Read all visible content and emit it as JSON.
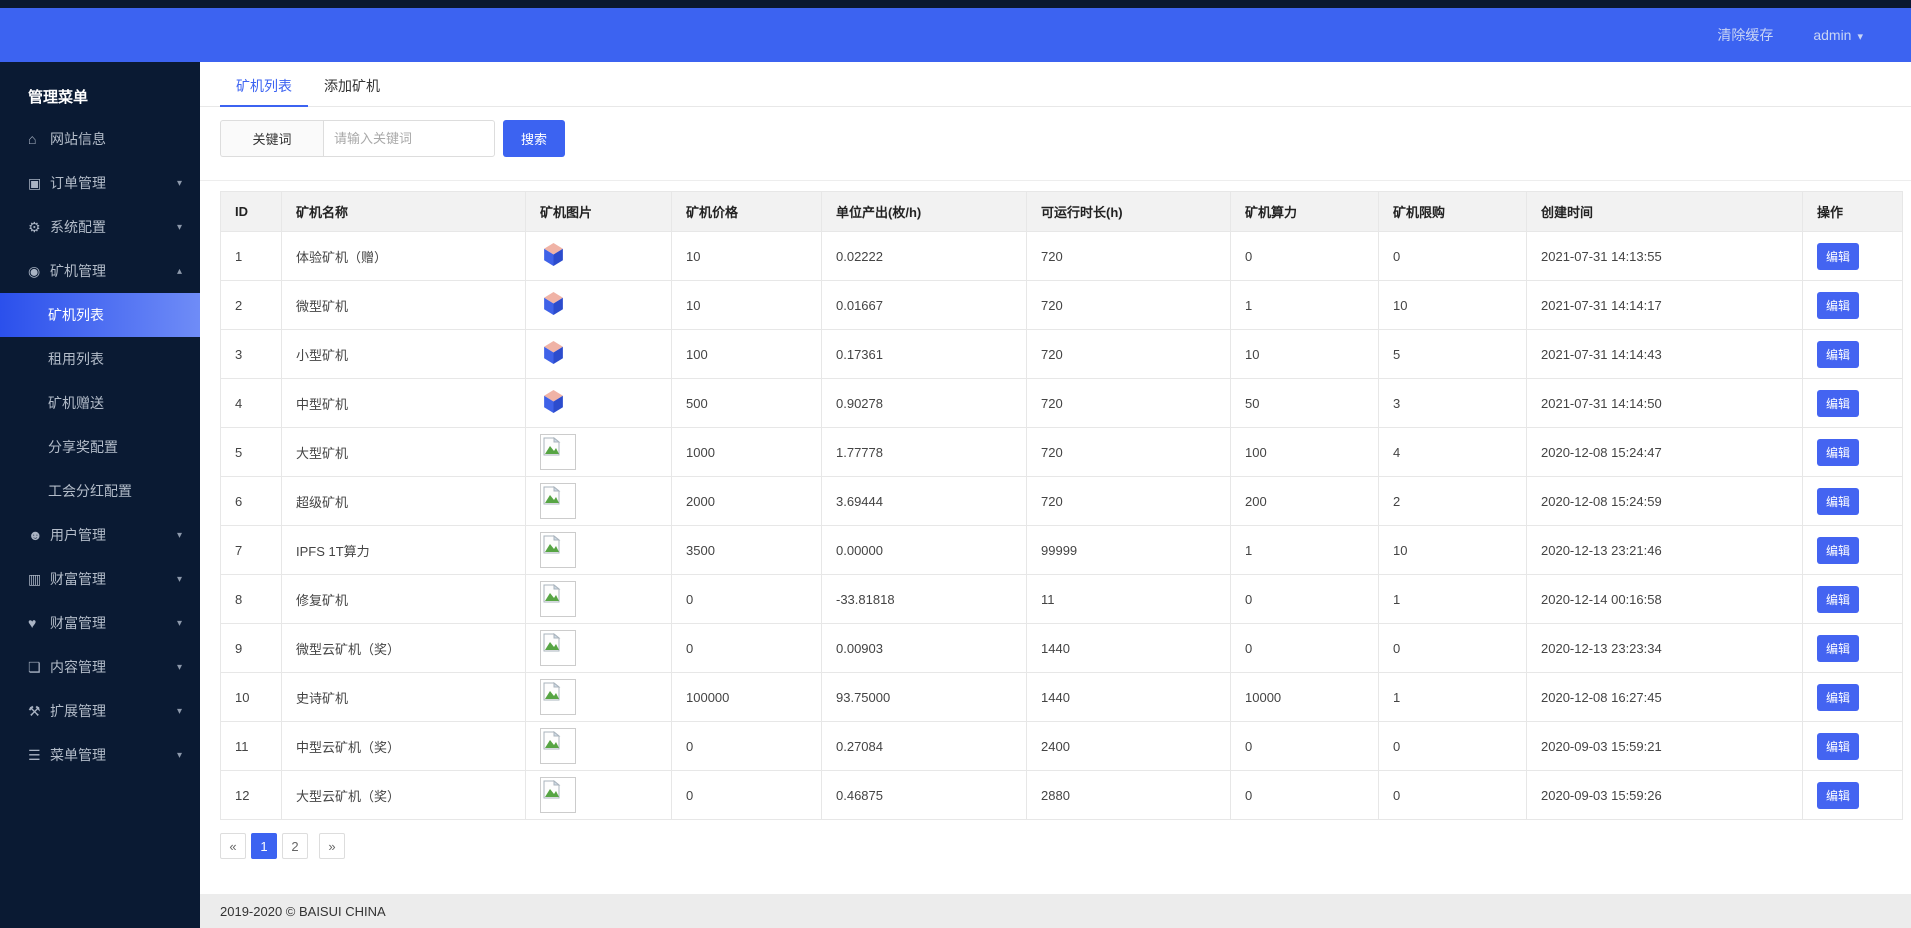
{
  "header": {
    "clear_cache": "清除缓存",
    "user": "admin"
  },
  "icons": {
    "caret_down": "▾",
    "caret_up": "▴"
  },
  "colors": {
    "accent": "#3c63f1",
    "header_bg": "#3c63f1",
    "sidebar_bg": "#0a1a33",
    "active_item_gradient": [
      "#2b50ec",
      "#6f8cf7"
    ],
    "footer_bg": "#ececec"
  },
  "sidebar": {
    "title": "管理菜单",
    "items": [
      {
        "label": "网站信息",
        "icon": "home-icon",
        "glyph": "⌂",
        "expandable": false
      },
      {
        "label": "订单管理",
        "icon": "orders-icon",
        "glyph": "▣",
        "expandable": true
      },
      {
        "label": "系统配置",
        "icon": "gears-icon",
        "glyph": "⚙",
        "expandable": true
      },
      {
        "label": "矿机管理",
        "icon": "miner-icon",
        "glyph": "◉",
        "expandable": true,
        "expanded": true,
        "children": [
          {
            "label": "矿机列表",
            "active": true
          },
          {
            "label": "租用列表"
          },
          {
            "label": "矿机赠送"
          },
          {
            "label": "分享奖配置"
          },
          {
            "label": "工会分红配置"
          }
        ]
      },
      {
        "label": "用户管理",
        "icon": "users-icon",
        "glyph": "☻",
        "expandable": true
      },
      {
        "label": "财富管理",
        "icon": "money-bill-icon",
        "glyph": "▥",
        "expandable": true
      },
      {
        "label": "财富管理",
        "icon": "heart-icon",
        "glyph": "♥",
        "expandable": true
      },
      {
        "label": "内容管理",
        "icon": "document-icon",
        "glyph": "❏",
        "expandable": true
      },
      {
        "label": "扩展管理",
        "icon": "wrench-icon",
        "glyph": "⚒",
        "expandable": true
      },
      {
        "label": "菜单管理",
        "icon": "bars-icon",
        "glyph": "☰",
        "expandable": true
      }
    ]
  },
  "tabs": [
    {
      "label": "矿机列表",
      "active": true
    },
    {
      "label": "添加矿机",
      "active": false
    }
  ],
  "search": {
    "label": "关键词",
    "placeholder": "请输入关键词",
    "button": "搜索"
  },
  "table": {
    "columns": [
      "ID",
      "矿机名称",
      "矿机图片",
      "矿机价格",
      "单位产出(枚/h)",
      "可运行时长(h)",
      "矿机算力",
      "矿机限购",
      "创建时间",
      "操作"
    ],
    "edit_label": "编辑",
    "rows": [
      {
        "id": "1",
        "name": "体验矿机（赠）",
        "image": "miner",
        "price": "10",
        "output": "0.02222",
        "hours": "720",
        "power": "0",
        "limit": "0",
        "created": "2021-07-31 14:13:55"
      },
      {
        "id": "2",
        "name": "微型矿机",
        "image": "miner",
        "price": "10",
        "output": "0.01667",
        "hours": "720",
        "power": "1",
        "limit": "10",
        "created": "2021-07-31 14:14:17"
      },
      {
        "id": "3",
        "name": "小型矿机",
        "image": "miner",
        "price": "100",
        "output": "0.17361",
        "hours": "720",
        "power": "10",
        "limit": "5",
        "created": "2021-07-31 14:14:43"
      },
      {
        "id": "4",
        "name": "中型矿机",
        "image": "miner",
        "price": "500",
        "output": "0.90278",
        "hours": "720",
        "power": "50",
        "limit": "3",
        "created": "2021-07-31 14:14:50"
      },
      {
        "id": "5",
        "name": "大型矿机",
        "image": "broken",
        "price": "1000",
        "output": "1.77778",
        "hours": "720",
        "power": "100",
        "limit": "4",
        "created": "2020-12-08 15:24:47"
      },
      {
        "id": "6",
        "name": "超级矿机",
        "image": "broken",
        "price": "2000",
        "output": "3.69444",
        "hours": "720",
        "power": "200",
        "limit": "2",
        "created": "2020-12-08 15:24:59"
      },
      {
        "id": "7",
        "name": "IPFS 1T算力",
        "image": "broken",
        "price": "3500",
        "output": "0.00000",
        "hours": "99999",
        "power": "1",
        "limit": "10",
        "created": "2020-12-13 23:21:46"
      },
      {
        "id": "8",
        "name": "修复矿机",
        "image": "broken",
        "price": "0",
        "output": "-33.81818",
        "hours": "11",
        "power": "0",
        "limit": "1",
        "created": "2020-12-14 00:16:58"
      },
      {
        "id": "9",
        "name": "微型云矿机（奖）",
        "image": "broken",
        "price": "0",
        "output": "0.00903",
        "hours": "1440",
        "power": "0",
        "limit": "0",
        "created": "2020-12-13 23:23:34"
      },
      {
        "id": "10",
        "name": "史诗矿机",
        "image": "broken",
        "price": "100000",
        "output": "93.75000",
        "hours": "1440",
        "power": "10000",
        "limit": "1",
        "created": "2020-12-08 16:27:45"
      },
      {
        "id": "11",
        "name": "中型云矿机（奖）",
        "image": "broken",
        "price": "0",
        "output": "0.27084",
        "hours": "2400",
        "power": "0",
        "limit": "0",
        "created": "2020-09-03 15:59:21"
      },
      {
        "id": "12",
        "name": "大型云矿机（奖）",
        "image": "broken",
        "price": "0",
        "output": "0.46875",
        "hours": "2880",
        "power": "0",
        "limit": "0",
        "created": "2020-09-03 15:59:26"
      }
    ]
  },
  "pagination": {
    "prev": "«",
    "pages": [
      "1",
      "2"
    ],
    "active": "1",
    "next": "»"
  },
  "footer": {
    "copyright": "2019-2020 © BAISUI CHINA"
  }
}
